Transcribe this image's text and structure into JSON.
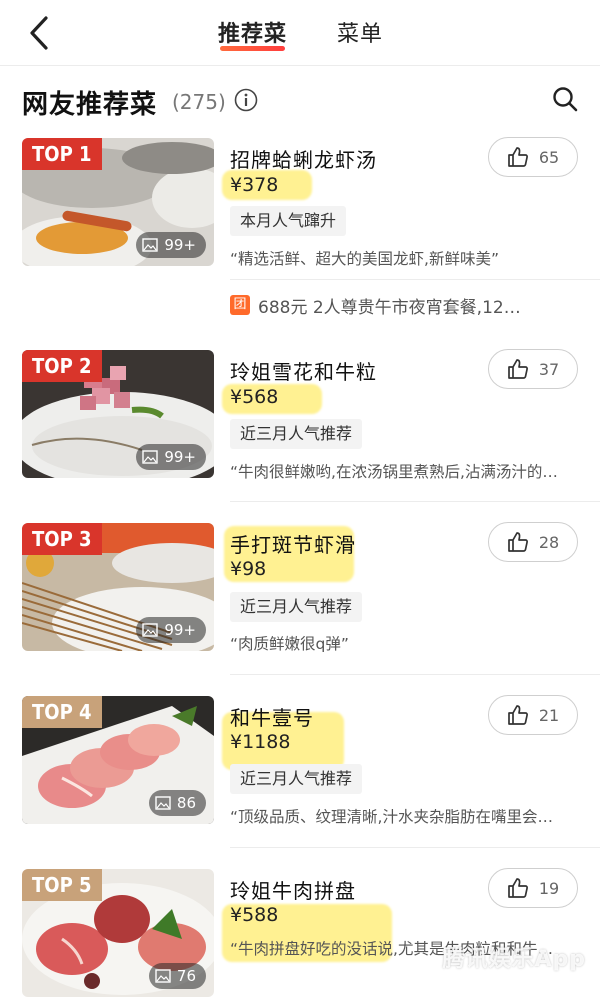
{
  "header": {
    "tabs": [
      {
        "label": "推荐菜",
        "active": true
      },
      {
        "label": "菜单",
        "active": false
      }
    ]
  },
  "section": {
    "title": "网友推荐菜",
    "count": "(275)"
  },
  "dishes": [
    {
      "rank": "TOP 1",
      "name": "招牌蛤蜊龙虾汤",
      "price": "¥378",
      "tag": "本月人气蹿升",
      "quote": "“精选活鲜、超大的美国龙虾,新鲜味美”",
      "likes": "65",
      "photos": "99+"
    },
    {
      "rank": "TOP 2",
      "name": "玲姐雪花和牛粒",
      "price": "¥568",
      "tag": "近三月人气推荐",
      "quote": "“牛肉很鲜嫩哟,在浓汤锅里煮熟后,沾满汤汁的…",
      "likes": "37",
      "photos": "99+"
    },
    {
      "rank": "TOP 3",
      "name": "手打斑节虾滑",
      "price": "¥98",
      "tag": "近三月人气推荐",
      "quote": "“肉质鲜嫩很q弹”",
      "likes": "28",
      "photos": "99+"
    },
    {
      "rank": "TOP 4",
      "name": "和牛壹号",
      "price": "¥1188",
      "tag": "近三月人气推荐",
      "quote": "“顶级品质、纹理清晰,汁水夹杂脂肪在嘴里会…",
      "likes": "21",
      "photos": "86"
    },
    {
      "rank": "TOP 5",
      "name": "玲姐牛肉拼盘",
      "price": "¥588",
      "tag": "",
      "quote": "“牛肉拼盘好吃的没话说,尤其是牛肉粒和和牛…",
      "likes": "19",
      "photos": "76"
    }
  ],
  "group_deal": {
    "badge": "团",
    "text": "688元 2人尊贵午市夜宵套餐,12…"
  },
  "watermark": "腾讯娱乐App",
  "colors": {
    "badge_red": "#d9352b",
    "badge_tan": "#c8a27a",
    "highlight": "#ffec6e",
    "accent": "#ff5a36"
  },
  "icons": [
    "back-arrow-icon",
    "info-icon",
    "search-icon",
    "thumbs-up-icon",
    "image-icon"
  ]
}
